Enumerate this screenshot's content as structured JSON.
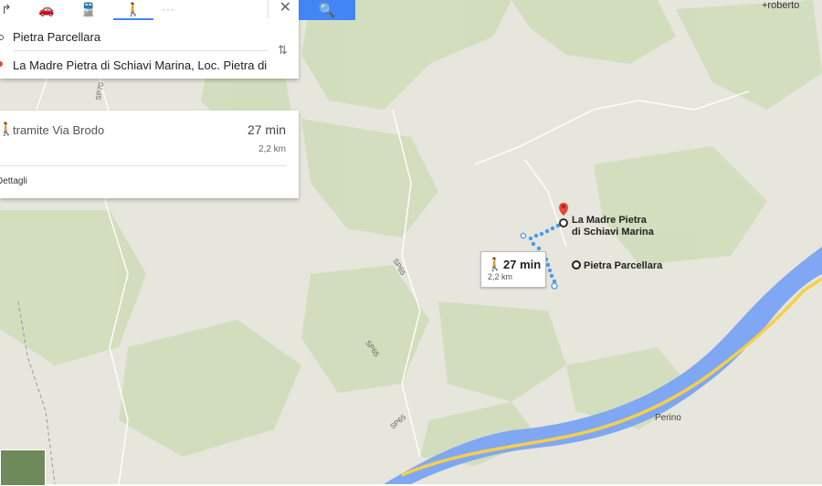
{
  "directions": {
    "modes": [
      {
        "name": "drive",
        "icon": "car-icon",
        "active": false
      },
      {
        "name": "transit",
        "icon": "train-icon",
        "active": false
      },
      {
        "name": "walk",
        "icon": "walking-icon",
        "active": true
      },
      {
        "name": "more",
        "icon": "more-icon",
        "active": false
      }
    ],
    "origin": "Pietra Parcellara",
    "destination": "La Madre Pietra di Schiavi Marina, Loc. Pietra di B",
    "search_icon": "search-icon",
    "close_icon": "close-icon",
    "swap_icon": "swap-icon"
  },
  "route": {
    "via": "tramite Via Brodo",
    "time": "27 min",
    "distance": "2,2 km",
    "details": "Dettagli"
  },
  "map": {
    "user": "+roberto",
    "destination_label": [
      "La Madre Pietra",
      "di Schiavi Marina"
    ],
    "origin_label": "Pietra Parcellara",
    "route_time": "27 min",
    "route_distance": "2,2 km",
    "roads": [
      "SP70",
      "SP65",
      "SP65",
      "SP65"
    ],
    "town": "Perino",
    "colors": {
      "land": "#e6e6dc",
      "forest": "#cfdcb8",
      "river": "#7fa7f3",
      "highway": "#f6cf4a",
      "route": "#4a9ae8",
      "marker": "#e8453c"
    }
  }
}
